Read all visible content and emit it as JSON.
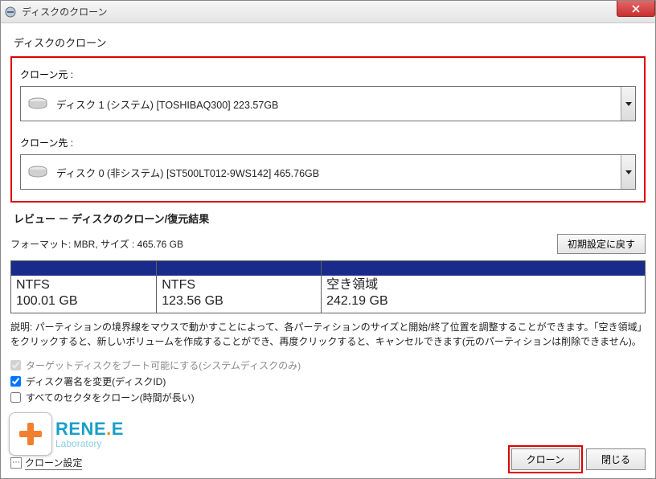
{
  "window": {
    "title": "ディスクのクローン"
  },
  "heading": "ディスクのクローン",
  "source": {
    "label": "クローン元 :",
    "text": "ディスク 1 (システム) [TOSHIBAQ300]   223.57GB"
  },
  "target": {
    "label": "クローン先 :",
    "text": "ディスク 0 (非システム) [ST500LT012-9WS142]   465.76GB"
  },
  "review": {
    "heading": "レビュー － ディスクのクローン/復元結果",
    "format": "フォーマット: MBR,  サイズ : 465.76 GB",
    "reset_btn": "初期設定に戻す",
    "partitions": [
      {
        "name": "NTFS",
        "size": "100.01 GB",
        "widthPct": 23
      },
      {
        "name": "NTFS",
        "size": "123.56 GB",
        "widthPct": 26
      },
      {
        "name": "空き領域",
        "size": "242.19 GB",
        "widthPct": 51
      }
    ]
  },
  "explanation": "説明: パーティションの境界線をマウスで動かすことによって、各パーティションのサイズと開始/終了位置を調整することができます。「空き領域」をクリックすると、新しいボリュームを作成することができ、再度クリックすると、キャンセルできます(元のパーティションは削除できません)。",
  "options": {
    "bootable": "ターゲットディスクをブート可能にする(システムディスクのみ)",
    "disksig": "ディスク署名を変更(ディスクID)",
    "sector": "すべてのセクタをクローン(時間が長い)"
  },
  "bottom": {
    "settings": "クローン設定",
    "clone": "クローン",
    "close": "閉じる"
  },
  "logo": {
    "brand_main": "RENE",
    "brand_dot": ".",
    "brand_e": "E",
    "sub": "Laboratory"
  }
}
